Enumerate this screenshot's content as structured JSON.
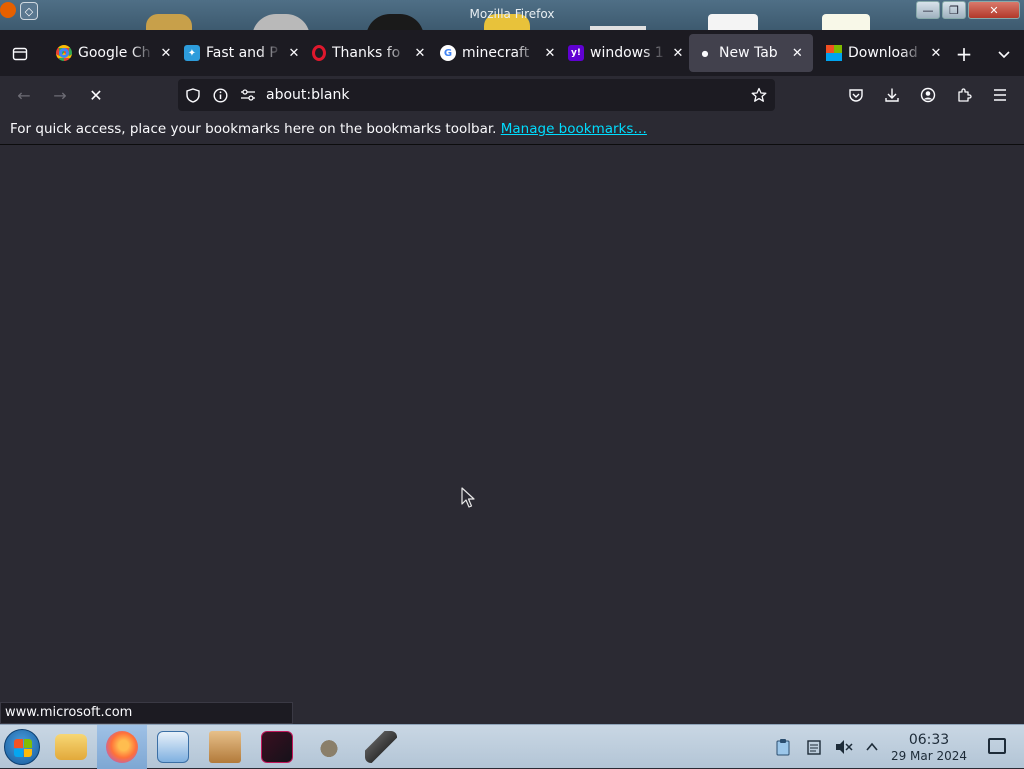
{
  "window": {
    "title": "Mozilla Firefox"
  },
  "window_controls": {
    "minimize": "—",
    "maximize": "❐",
    "close": "✕"
  },
  "tabs": [
    {
      "label": "Google Ch",
      "icon": "chrome-icon",
      "color": "#4285f4",
      "active": false
    },
    {
      "label": "Fast and P",
      "icon": "bird-icon",
      "color": "#2d9cdb",
      "active": false
    },
    {
      "label": "Thanks fo",
      "icon": "opera-icon",
      "color": "#e0182d",
      "active": false
    },
    {
      "label": "minecraft",
      "icon": "google-icon",
      "color": "#ffffff",
      "active": false
    },
    {
      "label": "windows 1",
      "icon": "yahoo-icon",
      "color": "#6001d2",
      "active": false
    },
    {
      "label": "New Tab",
      "icon": "loading-dot-icon",
      "color": "#fbfbfe",
      "active": true
    },
    {
      "label": "Download",
      "icon": "microsoft-icon",
      "color": "#f25022",
      "active": false
    }
  ],
  "navbar": {
    "url": "about:blank"
  },
  "bookmarks_bar": {
    "message": "For quick access, place your bookmarks here on the bookmarks toolbar.",
    "link": "Manage bookmarks…"
  },
  "status": {
    "url": "www.microsoft.com"
  },
  "taskbar": {
    "apps": [
      "file-manager-icon",
      "firefox-icon",
      "control-panel-icon",
      "package-icon",
      "editor-icon",
      "gimp-icon",
      "usb-drive-icon"
    ],
    "clock": {
      "time": "06:33",
      "date": "29 Mar 2024"
    }
  },
  "colors": {
    "toolbar_bg": "#2b2a33",
    "tabstrip_bg": "#1c1b22",
    "link": "#00ddff",
    "taskbar": "#c9d7e4"
  }
}
